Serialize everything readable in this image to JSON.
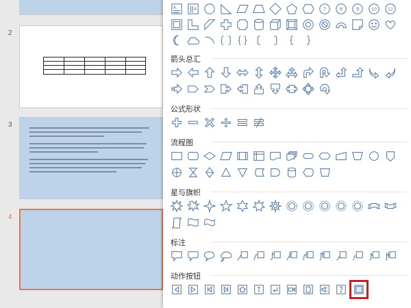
{
  "slides": [
    {
      "number": ""
    },
    {
      "number": "2"
    },
    {
      "number": "3"
    },
    {
      "number": "4"
    }
  ],
  "shape_panel": {
    "categories": [
      {
        "id": "basic",
        "title": ""
      },
      {
        "id": "arrows",
        "title": "箭头总汇"
      },
      {
        "id": "equation",
        "title": "公式形状"
      },
      {
        "id": "flowchart",
        "title": "流程图"
      },
      {
        "id": "stars",
        "title": "星与旗帜"
      },
      {
        "id": "callouts",
        "title": "标注"
      },
      {
        "id": "action",
        "title": "动作按钮"
      }
    ],
    "basic_row1_labels": [
      "7",
      "8",
      "9",
      "10",
      "12"
    ],
    "selected_shape": "action-button-custom",
    "accent_color": "#c8201f",
    "shape_stroke_color": "#5b7fa6",
    "selected_slide_border_color": "#e8744a"
  }
}
